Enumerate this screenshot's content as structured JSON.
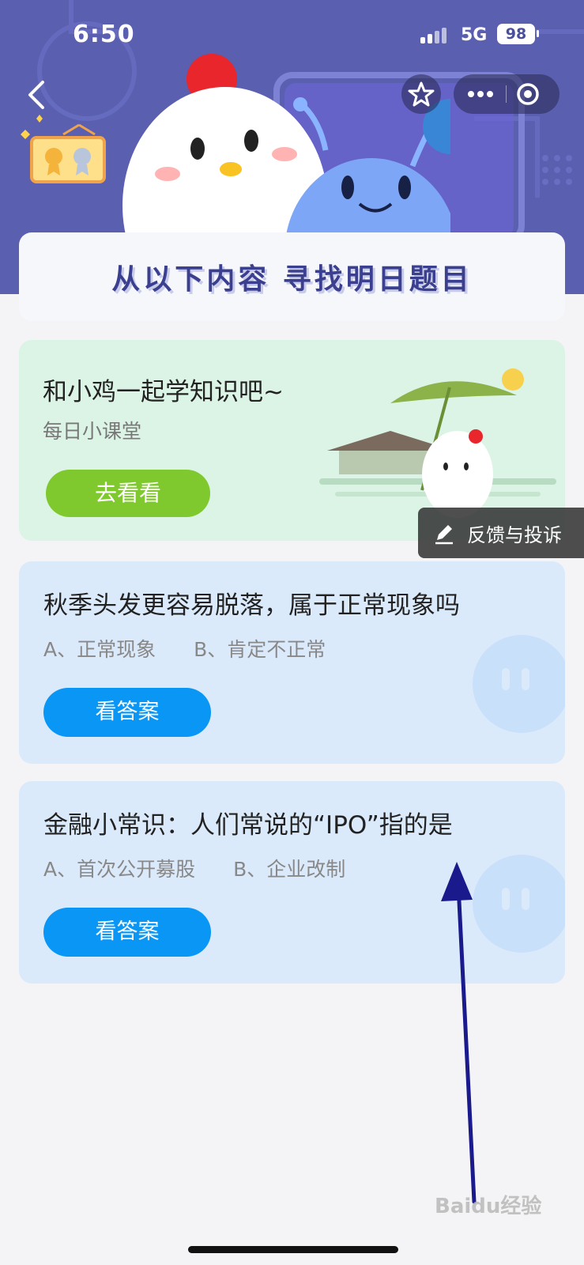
{
  "status_bar": {
    "time": "6:50",
    "network": "5G",
    "battery": "98"
  },
  "banner": {
    "title": "从以下内容 寻找明日题目"
  },
  "lesson_card": {
    "title": "和小鸡一起学知识吧~",
    "subtitle": "每日小课堂",
    "button_label": "去看看"
  },
  "feedback": {
    "label": "反馈与投诉"
  },
  "questions": [
    {
      "title": "秋季头发更容易脱落，属于正常现象吗",
      "option_a": "A、正常现象",
      "option_b": "B、肯定不正常",
      "button_label": "看答案"
    },
    {
      "title": "金融小常识：人们常说的“IPO”指的是",
      "option_a": "A、首次公开募股",
      "option_b": "B、企业改制",
      "button_label": "看答案"
    }
  ],
  "watermark": "Baidu经验",
  "colors": {
    "hero_bg": "#5a5fb0",
    "lesson_bg": "#dcf4e6",
    "question_bg": "#dbeafb",
    "go_button": "#7fc92f",
    "answer_button": "#0a96f5",
    "annotation_arrow": "#1a1a8c"
  }
}
